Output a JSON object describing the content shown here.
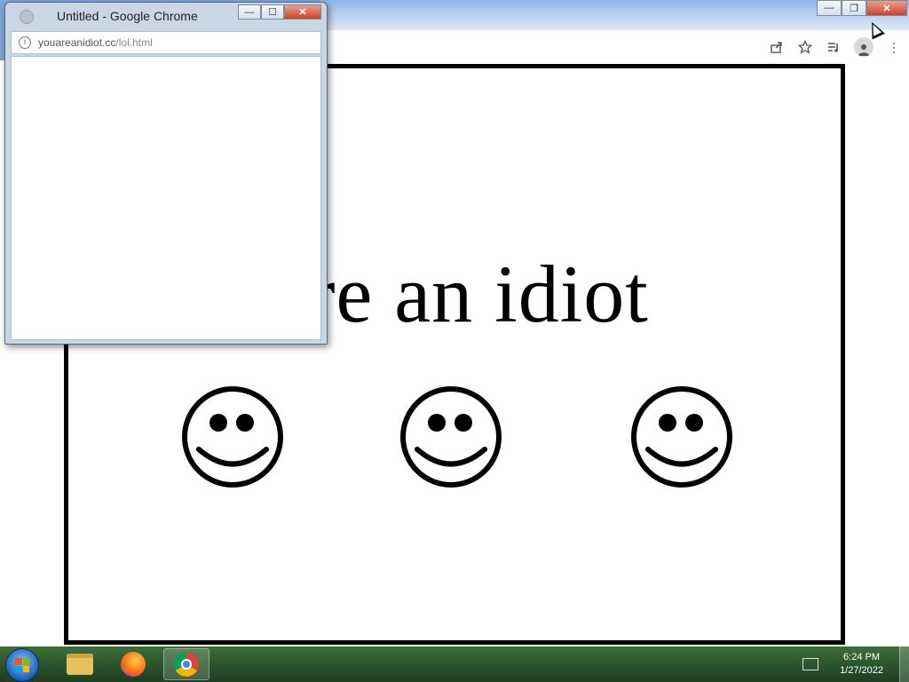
{
  "main_window": {
    "content": {
      "headline": "you are an idiot"
    }
  },
  "popup_window": {
    "title": "Untitled - Google Chrome",
    "address": {
      "domain": "youareanidiot.cc",
      "path": "/lol.html"
    }
  },
  "taskbar": {
    "apps": [
      {
        "name": "Windows Explorer",
        "icon": "folder-icon"
      },
      {
        "name": "Firefox",
        "icon": "firefox-icon"
      },
      {
        "name": "Google Chrome",
        "icon": "chrome-icon",
        "active": true
      }
    ],
    "clock": {
      "time": "6:24 PM",
      "date": "1/27/2022"
    }
  },
  "colors": {
    "frame_border": "#000000",
    "taskbar": "#2f5a2e",
    "close_button": "#c8442a"
  }
}
